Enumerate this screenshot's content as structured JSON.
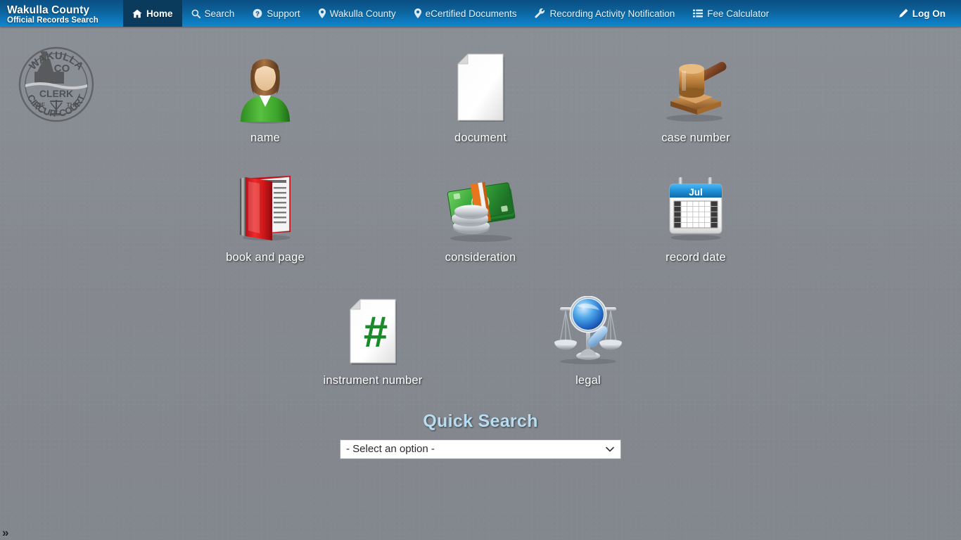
{
  "header": {
    "brand_title": "Wakulla County",
    "brand_subtitle": "Official Records Search",
    "nav": [
      {
        "label": "Home",
        "icon": "home-icon",
        "active": true
      },
      {
        "label": "Search",
        "icon": "search-icon",
        "active": false
      },
      {
        "label": "Support",
        "icon": "question-circle-icon",
        "active": false
      },
      {
        "label": "Wakulla County",
        "icon": "map-marker-icon",
        "active": false
      },
      {
        "label": "eCertified Documents",
        "icon": "map-marker-icon",
        "active": false
      },
      {
        "label": "Recording Activity Notification",
        "icon": "wrench-icon",
        "active": false
      },
      {
        "label": "Fee Calculator",
        "icon": "list-icon",
        "active": false
      }
    ],
    "log_on": {
      "label": "Log On",
      "icon": "pencil-icon"
    },
    "colors": {
      "nav_gradient_top": "#0a4f84",
      "nav_gradient_bottom": "#1187cf",
      "active_tab": "#0a3a5c"
    }
  },
  "seal": {
    "top_text": "WAKULLA",
    "center_text": "CO",
    "mid_text": "CLERK",
    "of_text": "OF",
    "the_text": "THE",
    "bottom_text": "CIRCUIT COURT"
  },
  "search_tiles": [
    {
      "label": "name",
      "icon": "person-icon"
    },
    {
      "label": "document",
      "icon": "document-icon"
    },
    {
      "label": "case number",
      "icon": "gavel-icon"
    },
    {
      "label": "book and page",
      "icon": "book-icon"
    },
    {
      "label": "consideration",
      "icon": "money-icon"
    },
    {
      "label": "record date",
      "icon": "calendar-icon"
    },
    {
      "label": "instrument number",
      "icon": "hash-document-icon"
    },
    {
      "label": "legal",
      "icon": "scales-magnifier-icon"
    }
  ],
  "calendar": {
    "month_label": "Jul"
  },
  "quick_search": {
    "title": "Quick Search",
    "selected_option": "- Select an option -",
    "options": [
      "- Select an option -"
    ]
  },
  "footer": {
    "expander": "»"
  },
  "colors": {
    "page_background": "#85898f",
    "label_text": "#ffffff",
    "quick_title": "#b8dcf0"
  }
}
